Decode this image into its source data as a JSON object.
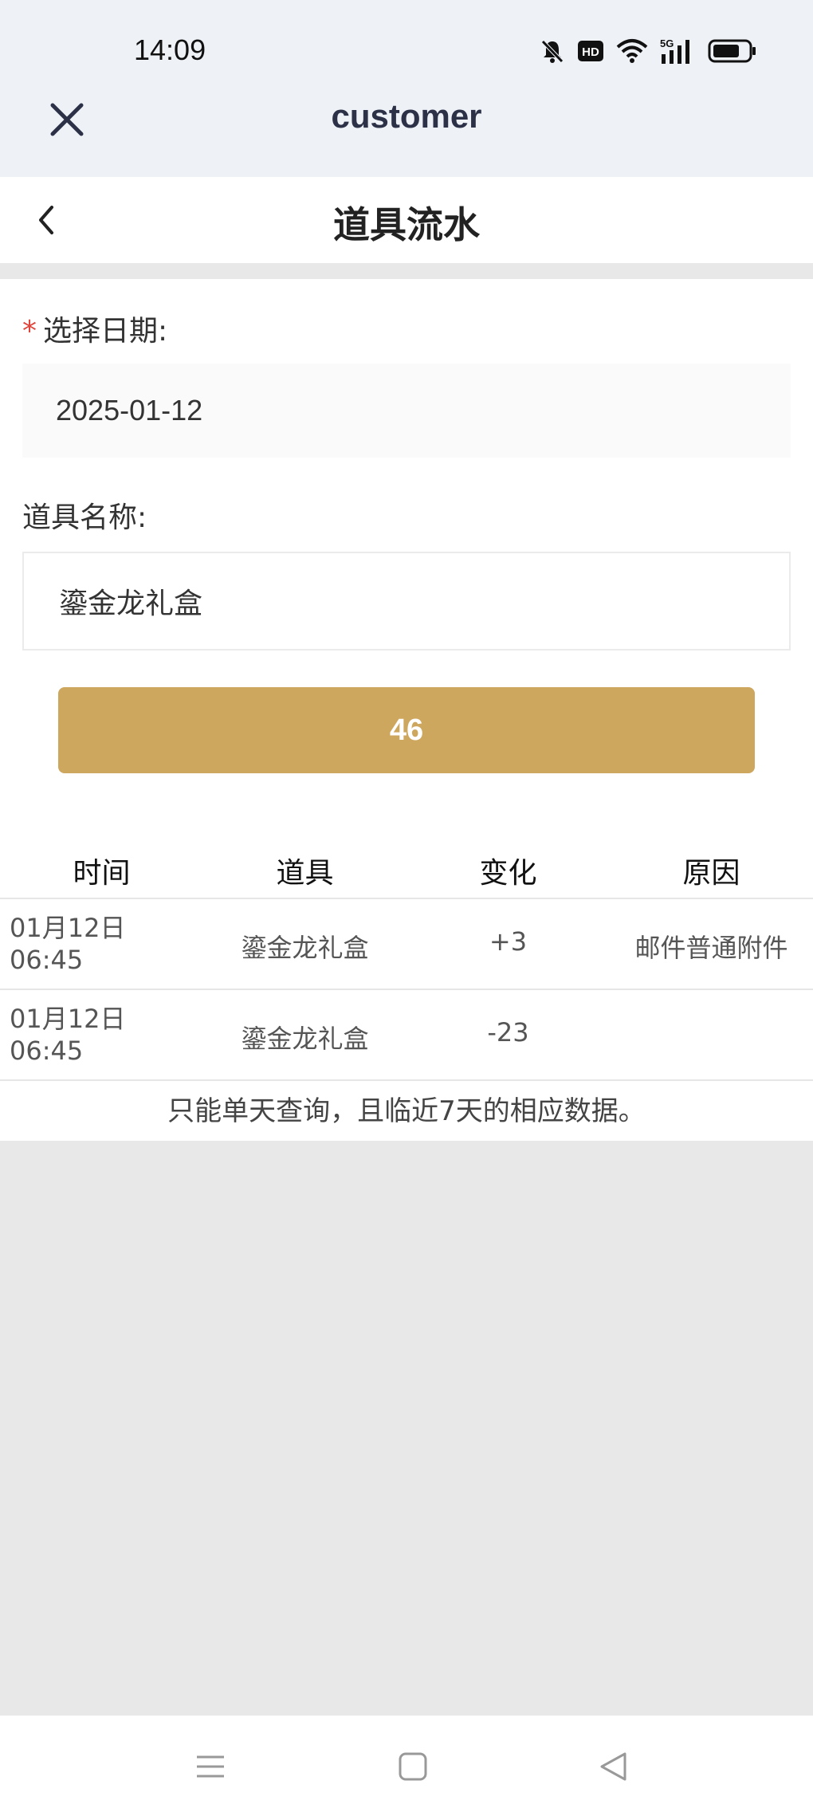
{
  "status_bar": {
    "time": "14:09",
    "icons": [
      "mute-bell-icon",
      "hd-icon",
      "wifi-icon",
      "5g-signal-icon",
      "battery-icon"
    ]
  },
  "app_header": {
    "title": "customer",
    "close_icon": "close-icon"
  },
  "page_header": {
    "title": "道具流水",
    "back_icon": "chevron-left-icon"
  },
  "form": {
    "date_label": "选择日期:",
    "date_required_mark": "*",
    "date_value": "2025-01-12",
    "item_label": "道具名称:",
    "item_value": "鎏金龙礼盒",
    "button_label": "46",
    "button_color": "#cea75e"
  },
  "table": {
    "headers": [
      "时间",
      "道具",
      "变化",
      "原因"
    ],
    "rows": [
      {
        "date": "01月12日",
        "time": "06:45",
        "item": "鎏金龙礼盒",
        "change": "+3",
        "reason": "邮件普通附件"
      },
      {
        "date": "01月12日",
        "time": "06:45",
        "item": "鎏金龙礼盒",
        "change": "-23",
        "reason": ""
      }
    ],
    "note": "只能单天查询，且临近7天的相应数据。"
  },
  "nav_bar": {
    "icons": [
      "menu-icon",
      "home-square-icon",
      "back-triangle-icon"
    ]
  }
}
